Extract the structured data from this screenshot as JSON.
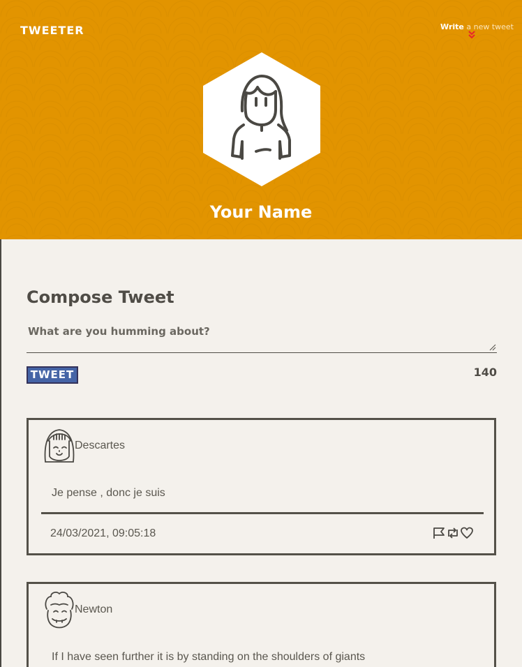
{
  "header": {
    "logo": "TWEETER",
    "nav_write_bold": "Write",
    "nav_write_rest": " a new tweet",
    "user_name": "Your Name",
    "background_color": "#e29400"
  },
  "compose": {
    "title": "Compose Tweet",
    "placeholder": "What are you humming about?",
    "value": "",
    "button_label": "TWEET",
    "counter": "140"
  },
  "tweets": [
    {
      "user": "Descartes",
      "text": "Je pense , donc je suis",
      "timestamp": "24/03/2021, 09:05:18",
      "actions": [
        "flag-icon",
        "retweet-icon",
        "heart-icon"
      ]
    },
    {
      "user": "Newton",
      "text": "If I have seen further it is by standing on the shoulders of giants"
    }
  ]
}
